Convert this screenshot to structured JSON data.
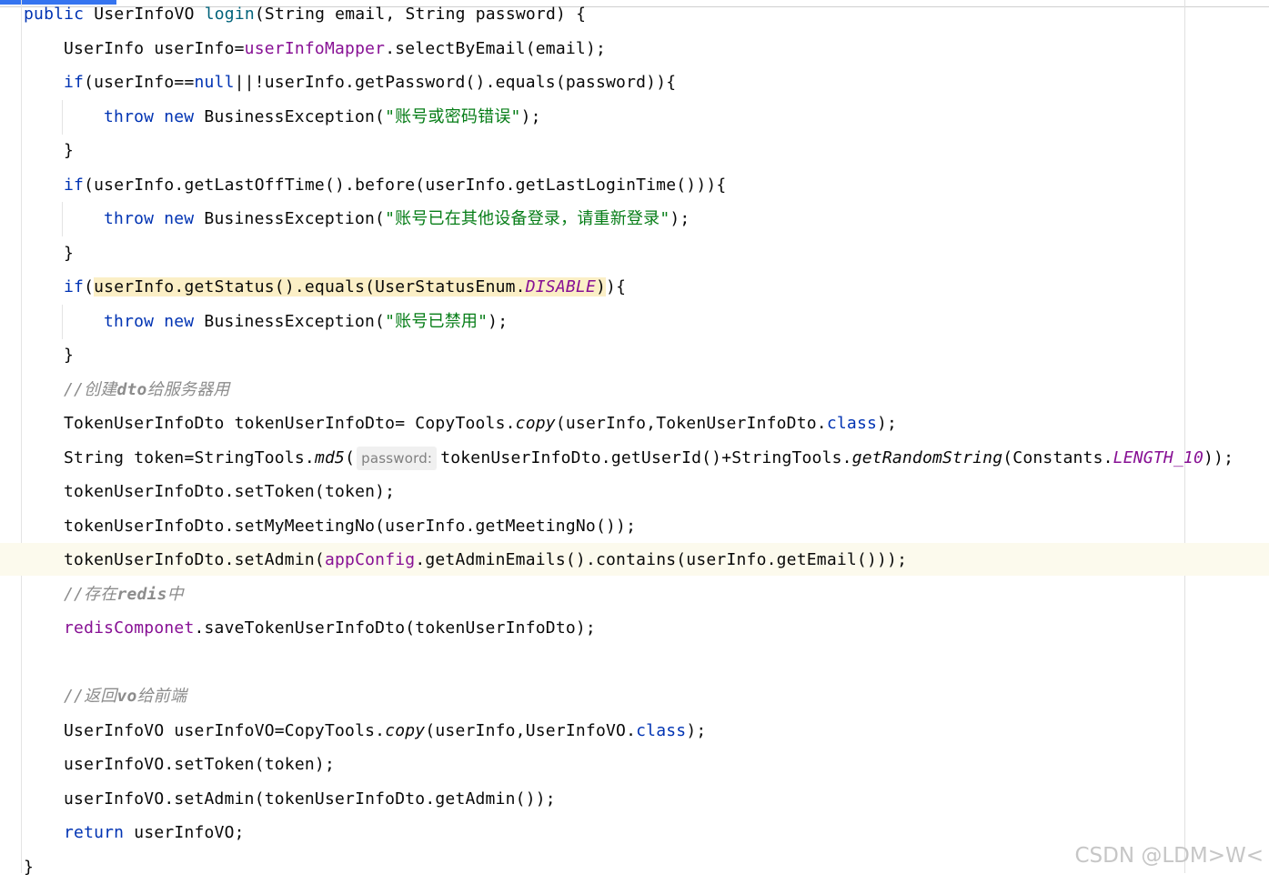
{
  "editor": {
    "method_signature": [
      "public",
      "UserInfoVO",
      "login",
      "(String email, String password) {"
    ],
    "l2": [
      "UserInfo userInfo=",
      "userInfoMapper",
      ".selectByEmail(email);"
    ],
    "l3": [
      "if",
      "(userInfo==",
      "null",
      "||!userInfo.getPassword().equals(password)){"
    ],
    "l4": [
      "throw",
      "new",
      "BusinessException(",
      "\"账号或密码错误\"",
      ");"
    ],
    "l5": "}",
    "l6": [
      "if",
      "(userInfo.getLastOffTime().before(userInfo.getLastLoginTime())){"
    ],
    "l7": [
      "throw",
      "new",
      "BusinessException(",
      "\"账号已在其他设备登录，请重新登录\"",
      ");"
    ],
    "l8": "}",
    "l9": [
      "if",
      "(",
      "userInfo.getStatus().equals(UserStatusEnum.",
      "DISABLE",
      ")",
      "){"
    ],
    "l10": [
      "throw",
      "new",
      "BusinessException(",
      "\"账号已禁用\"",
      ");"
    ],
    "l11": "}",
    "c1": [
      "//创建",
      "dto",
      "给服务器用"
    ],
    "l12": [
      "TokenUserInfoDto tokenUserInfoDto= CopyTools.",
      "copy",
      "(userInfo,TokenUserInfoDto.",
      "class",
      ");"
    ],
    "l13": [
      "String token=StringTools.",
      "md5",
      "(",
      "password:",
      "tokenUserInfoDto.getUserId()+StringTools.",
      "getRandomString",
      "(Constants.",
      "LENGTH_10",
      "));"
    ],
    "l14": "tokenUserInfoDto.setToken(token);",
    "l15": "tokenUserInfoDto.setMyMeetingNo(userInfo.getMeetingNo());",
    "l16": [
      "tokenUserInfoDto.setAdmin(",
      "appConfig",
      ".getAdminEmails().contains(userInfo.getEmail()));"
    ],
    "c2": [
      "//存在",
      "redis",
      "中"
    ],
    "l17": [
      "redisComponet",
      ".saveTokenUserInfoDto(tokenUserInfoDto);"
    ],
    "c3": [
      "//返回",
      "vo",
      "给前端"
    ],
    "l18": [
      "UserInfoVO userInfoVO=CopyTools.",
      "copy",
      "(userInfo,UserInfoVO.",
      "class",
      ");"
    ],
    "l19": "userInfoVO.setToken(token);",
    "l20": "userInfoVO.setAdmin(tokenUserInfoDto.getAdmin());",
    "l21": [
      "return",
      "userInfoVO;"
    ],
    "l22": "}"
  },
  "watermark": "CSDN @LDM>W<",
  "colors": {
    "keyword": "#0033b3",
    "field": "#871094",
    "string": "#067d17",
    "comment": "#8c8c8c",
    "method_decl": "#00627a",
    "highlight": "#fbefc6",
    "current_line": "#fcfaed"
  }
}
